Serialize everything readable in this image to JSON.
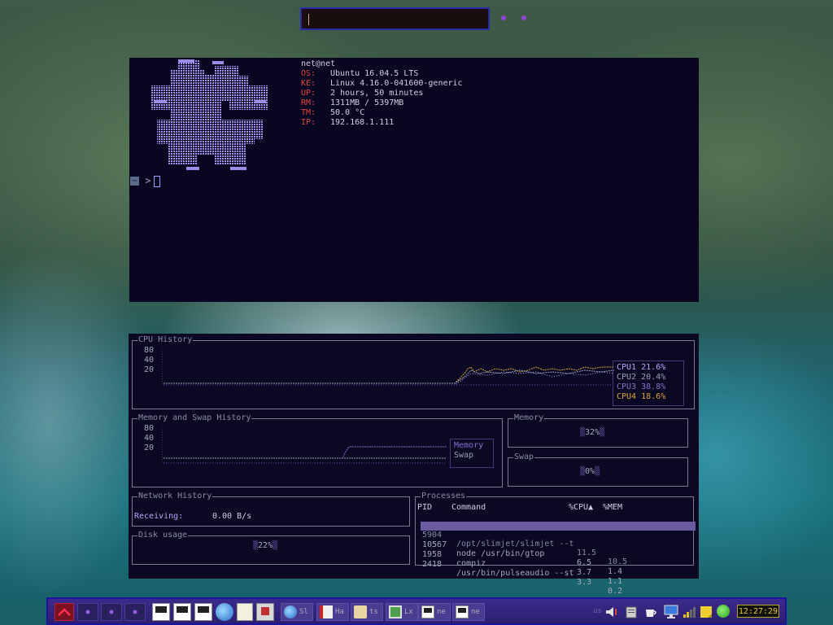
{
  "terminal": {
    "user_host": "net@net",
    "info": [
      {
        "key": "OS:",
        "value": "Ubuntu 16.04.5 LTS"
      },
      {
        "key": "KE:",
        "value": "Linux 4.16.0-041600-generic"
      },
      {
        "key": "UP:",
        "value": "2 hours, 50 minutes"
      },
      {
        "key": "RM:",
        "value": "1311MB / 5397MB"
      },
      {
        "key": "TM:",
        "value": "50.0 °C"
      },
      {
        "key": "IP:",
        "value": "192.168.1.111"
      }
    ],
    "prompt_dir": "~",
    "prompt_symbol": ">"
  },
  "gtop": {
    "cpu": {
      "title": "CPU History",
      "ticks": [
        "80",
        "40",
        "20"
      ],
      "legend": [
        {
          "name": "CPU1",
          "value": "21.6%",
          "color": "#b8aaff"
        },
        {
          "name": "CPU2",
          "value": "20.4%",
          "color": "#9aa0b8"
        },
        {
          "name": "CPU3",
          "value": "38.8%",
          "color": "#8a70d0"
        },
        {
          "name": "CPU4",
          "value": "18.6%",
          "color": "#d8a840"
        }
      ]
    },
    "memory_history": {
      "title": "Memory and Swap History",
      "ticks": [
        "80",
        "40",
        "20"
      ],
      "legend": [
        {
          "name": "Memory",
          "color": "#8a70d0"
        },
        {
          "name": "Swap",
          "color": "#9aa0b8"
        }
      ]
    },
    "memory": {
      "title": "Memory",
      "value": "32%"
    },
    "swap": {
      "title": "Swap",
      "value": "0%"
    },
    "network": {
      "title": "Network History",
      "label": "Receiving:",
      "value": "0.00 B/s"
    },
    "disk": {
      "title": "Disk usage",
      "value": "22%"
    },
    "processes": {
      "title": "Processes",
      "headers": {
        "pid": "PID",
        "command": "Command",
        "cpu": "%CPU▲",
        "mem": "%MEM"
      },
      "rows": [
        {
          "pid": "5904",
          "command": "/opt/slimjet/slimjet --t",
          "cpu": "11.5",
          "mem": "10.5",
          "selected": true
        },
        {
          "pid": "10567",
          "command": "node /usr/bin/gtop",
          "cpu": "6.5",
          "mem": "1.4"
        },
        {
          "pid": "1958",
          "command": "compiz",
          "cpu": "3.7",
          "mem": "1.1"
        },
        {
          "pid": "2418",
          "command": "/usr/bin/pulseaudio --st",
          "cpu": "3.3",
          "mem": "0.2"
        }
      ]
    }
  },
  "taskbar": {
    "tasks": [
      {
        "label": "Sl",
        "icon": "globe-icon"
      },
      {
        "label": "Ha",
        "icon": "document-icon"
      },
      {
        "label": "ts",
        "icon": "folder-icon"
      },
      {
        "label": "Lx",
        "icon": "text-editor-icon"
      },
      {
        "label": "ne",
        "icon": "terminal-icon"
      },
      {
        "label": "ne",
        "icon": "terminal-icon"
      }
    ],
    "keyboard_layout": "us",
    "clock": "12:27:29"
  },
  "colors": {
    "terminal_bg": "#080620",
    "accent_red": "#e0473f",
    "accent_purple": "#8a70d0",
    "clock_text": "#e6c830"
  }
}
